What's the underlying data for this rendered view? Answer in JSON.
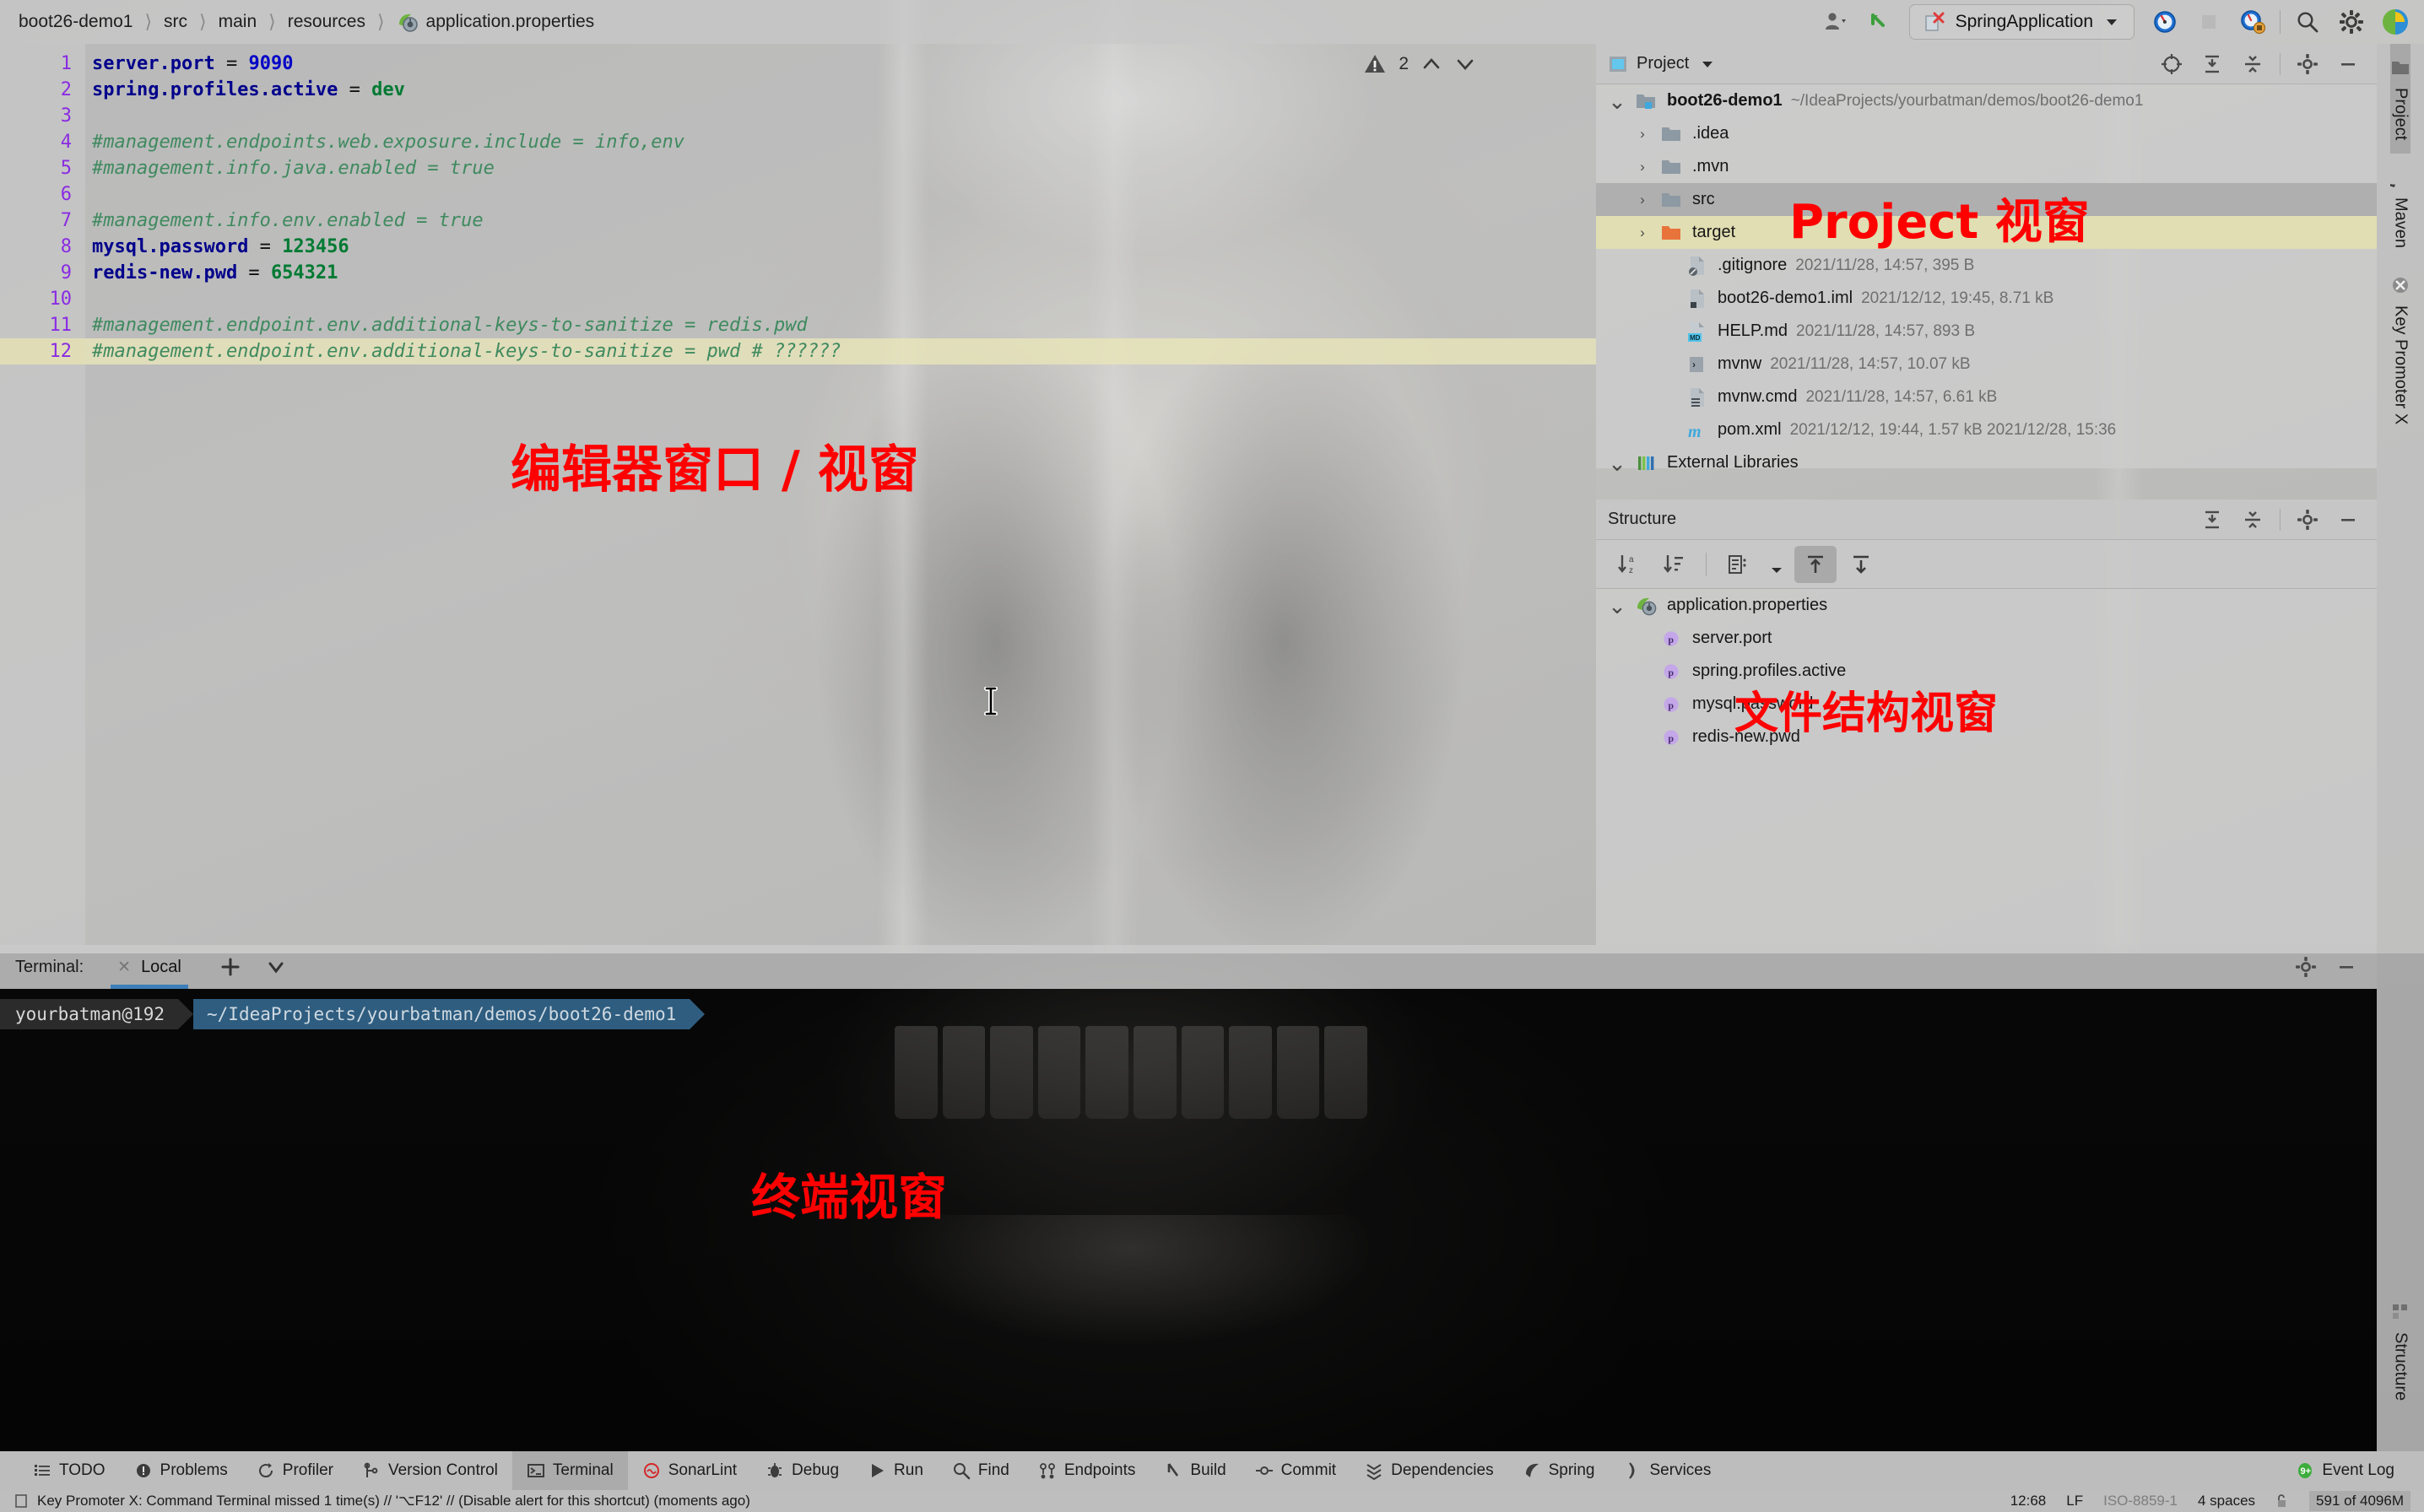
{
  "breadcrumb": {
    "items": [
      "boot26-demo1",
      "src",
      "main",
      "resources",
      "application.properties"
    ],
    "file_icon": "spring-properties-icon"
  },
  "toolbar": {
    "account_label": "account-icon",
    "update_label": "update-project-icon",
    "run_config": "SpringApplication",
    "run_label": "run-icon",
    "stop_label": "stop-icon",
    "debug_label": "debug-icon",
    "search_label": "search-icon",
    "settings_label": "gear-icon",
    "spring_label": "spring-boot-icon"
  },
  "editor": {
    "warning_count": "2",
    "lines": [
      {
        "n": "1",
        "tokens": [
          {
            "t": "key",
            "v": "server.port"
          },
          {
            "t": "eq",
            "v": " = "
          },
          {
            "t": "num",
            "v": "9090"
          }
        ]
      },
      {
        "n": "2",
        "tokens": [
          {
            "t": "key",
            "v": "spring.profiles.active"
          },
          {
            "t": "eq",
            "v": " = "
          },
          {
            "t": "val",
            "v": "dev"
          }
        ]
      },
      {
        "n": "3",
        "tokens": []
      },
      {
        "n": "4",
        "tokens": [
          {
            "t": "cmt",
            "v": "#management.endpoints.web.exposure.include = info,env"
          }
        ]
      },
      {
        "n": "5",
        "tokens": [
          {
            "t": "cmt",
            "v": "#management.info.java.enabled = true"
          }
        ]
      },
      {
        "n": "6",
        "tokens": []
      },
      {
        "n": "7",
        "tokens": [
          {
            "t": "cmt",
            "v": "#management.info.env.enabled = true"
          }
        ]
      },
      {
        "n": "8",
        "tokens": [
          {
            "t": "key",
            "v": "mysql.password"
          },
          {
            "t": "eq",
            "v": " = "
          },
          {
            "t": "val",
            "v": "123456"
          }
        ]
      },
      {
        "n": "9",
        "tokens": [
          {
            "t": "key",
            "v": "redis-new.pwd"
          },
          {
            "t": "eq",
            "v": " = "
          },
          {
            "t": "val",
            "v": "654321"
          }
        ]
      },
      {
        "n": "10",
        "tokens": []
      },
      {
        "n": "11",
        "tokens": [
          {
            "t": "cmt",
            "v": "#management.endpoint.env.additional-keys-to-sanitize = redis.pwd"
          }
        ]
      },
      {
        "n": "12",
        "tokens": [
          {
            "t": "cmt",
            "v": "#management.endpoint.env.additional-keys-to-sanitize = pwd # ??????"
          }
        ],
        "current": true
      }
    ]
  },
  "project_panel": {
    "title": "Project",
    "dropdown_icon": "chevron-down-icon",
    "actions": [
      "locate-icon",
      "expand-all-icon",
      "collapse-all-icon",
      "gear-icon",
      "minimize-icon"
    ],
    "rows": [
      {
        "indent": 0,
        "arrow": "v",
        "icon": "module-folder-icon",
        "name": "boot26-demo1",
        "bold": true,
        "meta": "~/IdeaProjects/yourbatman/demos/boot26-demo1"
      },
      {
        "indent": 1,
        "arrow": ">",
        "icon": "folder-icon",
        "name": ".idea",
        "meta": ""
      },
      {
        "indent": 1,
        "arrow": ">",
        "icon": "folder-icon",
        "name": ".mvn",
        "meta": ""
      },
      {
        "indent": 1,
        "arrow": ">",
        "icon": "source-folder-icon",
        "name": "src",
        "meta": "",
        "selection": "grey"
      },
      {
        "indent": 1,
        "arrow": ">",
        "icon": "target-folder-icon",
        "name": "target",
        "meta": "",
        "selection": "khaki"
      },
      {
        "indent": 2,
        "arrow": "",
        "icon": "gitignore-file-icon",
        "name": ".gitignore",
        "meta": "2021/11/28, 14:57, 395 B"
      },
      {
        "indent": 2,
        "arrow": "",
        "icon": "iml-file-icon",
        "name": "boot26-demo1.iml",
        "meta": "2021/12/12, 19:45, 8.71 kB"
      },
      {
        "indent": 2,
        "arrow": "",
        "icon": "markdown-file-icon",
        "name": "HELP.md",
        "meta": "2021/11/28, 14:57, 893 B"
      },
      {
        "indent": 2,
        "arrow": "",
        "icon": "shell-file-icon",
        "name": "mvnw",
        "meta": "2021/11/28, 14:57, 10.07 kB"
      },
      {
        "indent": 2,
        "arrow": "",
        "icon": "cmd-file-icon",
        "name": "mvnw.cmd",
        "meta": "2021/11/28, 14:57, 6.61 kB"
      },
      {
        "indent": 2,
        "arrow": "",
        "icon": "maven-file-icon",
        "name": "pom.xml",
        "meta": "2021/12/12, 19:44, 1.57 kB 2021/12/28, 15:36"
      },
      {
        "indent": 0,
        "arrow": "v",
        "icon": "libraries-icon",
        "name": "External Libraries",
        "meta": ""
      }
    ]
  },
  "structure_panel": {
    "title": "Structure",
    "actions": [
      "expand-all-icon",
      "collapse-all-icon",
      "gear-icon",
      "minimize-icon"
    ],
    "toolbar": [
      "sort-alphabetically-icon",
      "sort-by-type-icon",
      "group-icon",
      "chevron-down-icon",
      "scroll-from-source-icon",
      "scroll-to-source-icon"
    ],
    "rows": [
      {
        "indent": 0,
        "arrow": "v",
        "icon": "spring-properties-icon",
        "name": "application.properties"
      },
      {
        "indent": 1,
        "arrow": "",
        "icon": "property-icon",
        "name": "server.port"
      },
      {
        "indent": 1,
        "arrow": "",
        "icon": "property-icon",
        "name": "spring.profiles.active"
      },
      {
        "indent": 1,
        "arrow": "",
        "icon": "property-icon",
        "name": "mysql.password"
      },
      {
        "indent": 1,
        "arrow": "",
        "icon": "property-icon",
        "name": "redis-new.pwd"
      }
    ]
  },
  "terminal": {
    "label": "Terminal:",
    "tab_name": "Local",
    "add_label": "add-tab-icon",
    "dropdown_label": "chevron-down-icon",
    "settings_label": "gear-icon",
    "minimize_label": "minimize-icon",
    "prompt_user": "yourbatman@192",
    "prompt_path": "~/IdeaProjects/yourbatman/demos/boot26-demo1"
  },
  "right_rail": {
    "top_tabs": [
      {
        "label": "Project",
        "icon": "project-icon",
        "active": true
      },
      {
        "label": "Maven",
        "icon": "maven-icon",
        "active": false
      },
      {
        "label": "Key Promoter X",
        "icon": "key-promoter-icon",
        "active": false
      }
    ],
    "bottom_tabs": [
      {
        "label": "Structure",
        "icon": "structure-icon",
        "active": false
      }
    ]
  },
  "bottom_bar": {
    "items": [
      {
        "label": "TODO",
        "icon": "todo-icon",
        "active": false
      },
      {
        "label": "Problems",
        "icon": "problems-icon",
        "active": false
      },
      {
        "label": "Profiler",
        "icon": "profiler-icon",
        "active": false
      },
      {
        "label": "Version Control",
        "icon": "vcs-icon",
        "active": false
      },
      {
        "label": "Terminal",
        "icon": "terminal-icon",
        "active": true
      },
      {
        "label": "SonarLint",
        "icon": "sonarlint-icon",
        "active": false
      },
      {
        "label": "Debug",
        "icon": "debug-icon",
        "active": false
      },
      {
        "label": "Run",
        "icon": "run-icon",
        "active": false
      },
      {
        "label": "Find",
        "icon": "find-icon",
        "active": false
      },
      {
        "label": "Endpoints",
        "icon": "endpoints-icon",
        "active": false
      },
      {
        "label": "Build",
        "icon": "build-icon",
        "active": false
      },
      {
        "label": "Commit",
        "icon": "commit-icon",
        "active": false
      },
      {
        "label": "Dependencies",
        "icon": "dependencies-icon",
        "active": false
      },
      {
        "label": "Spring",
        "icon": "spring-icon",
        "active": false
      },
      {
        "label": "Services",
        "icon": "services-icon",
        "active": false
      }
    ],
    "event_log": {
      "label": "Event Log",
      "icon": "event-log-icon"
    }
  },
  "status_bar": {
    "message": "Key Promoter X: Command Terminal missed 1 time(s) // '⌥F12' // (Disable alert for this shortcut) (moments ago)",
    "message_icon": "notification-icon",
    "caret_position": "12:68",
    "line_separator": "LF",
    "encoding": "ISO-8859-1",
    "indent": "4 spaces",
    "lock_icon": "unlocked-icon",
    "memory": "591 of 4096M"
  },
  "annotations": {
    "editor": "编辑器窗口 / 视窗",
    "project": "Project 视窗",
    "structure": "文件结构视窗",
    "terminal": "终端视窗"
  },
  "colors": {
    "annotation_red": "#ff0000",
    "accent_blue": "#3d7eb8",
    "keyword_blue": "#00008b",
    "value_green": "#007a33",
    "comment_green": "#3f8a5f",
    "lineno_purple": "#8a2be2",
    "selection_khaki": "#e2e0b0"
  }
}
